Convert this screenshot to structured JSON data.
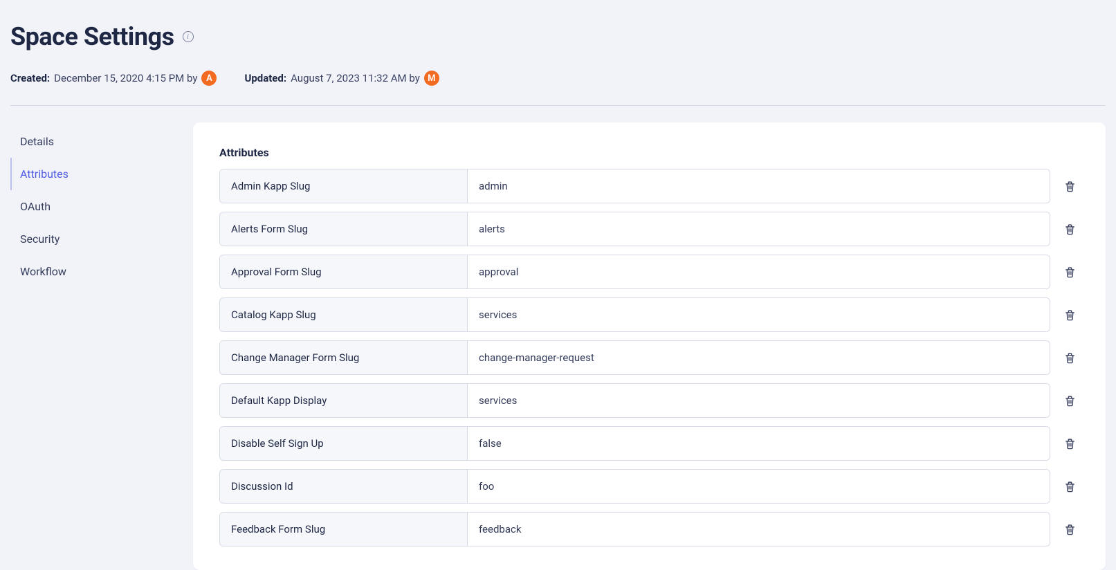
{
  "page": {
    "title": "Space Settings"
  },
  "meta": {
    "created_label": "Created:",
    "created_value": "December 15, 2020 4:15 PM by",
    "created_avatar": "A",
    "updated_label": "Updated:",
    "updated_value": "August 7, 2023 11:32 AM by",
    "updated_avatar": "M"
  },
  "tabs": [
    {
      "label": "Details",
      "active": false
    },
    {
      "label": "Attributes",
      "active": true
    },
    {
      "label": "OAuth",
      "active": false
    },
    {
      "label": "Security",
      "active": false
    },
    {
      "label": "Workflow",
      "active": false
    }
  ],
  "section": {
    "heading": "Attributes"
  },
  "attributes": [
    {
      "name": "Admin Kapp Slug",
      "value": "admin"
    },
    {
      "name": "Alerts Form Slug",
      "value": "alerts"
    },
    {
      "name": "Approval Form Slug",
      "value": "approval"
    },
    {
      "name": "Catalog Kapp Slug",
      "value": "services"
    },
    {
      "name": "Change Manager Form Slug",
      "value": "change-manager-request"
    },
    {
      "name": "Default Kapp Display",
      "value": "services"
    },
    {
      "name": "Disable Self Sign Up",
      "value": "false"
    },
    {
      "name": "Discussion Id",
      "value": "foo"
    },
    {
      "name": "Feedback Form Slug",
      "value": "feedback"
    }
  ]
}
